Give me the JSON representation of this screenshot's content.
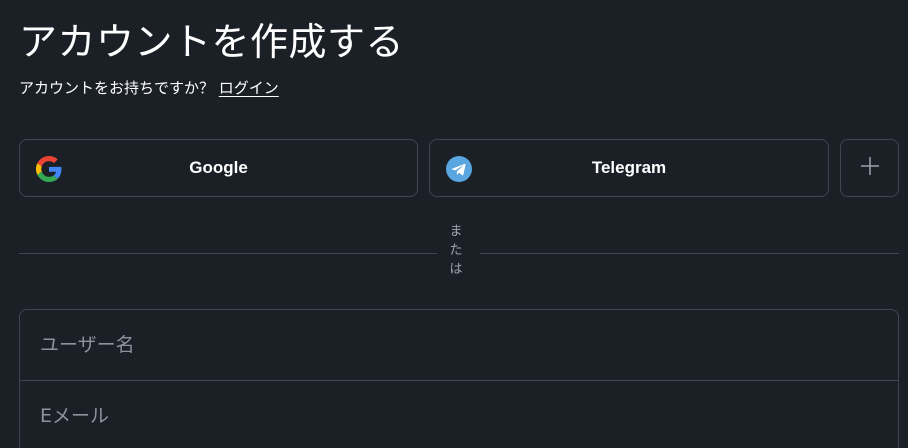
{
  "heading": {
    "title": "アカウントを作成する"
  },
  "login_prompt": {
    "text": "アカウントをお持ちですか？",
    "link_label": "ログイン"
  },
  "social": {
    "google_label": "Google",
    "telegram_label": "Telegram",
    "more_icon": "plus-icon"
  },
  "divider": {
    "text": "または"
  },
  "form": {
    "username_placeholder": "ユーザー名",
    "email_placeholder": "Eメール"
  },
  "colors": {
    "background": "#1b2027",
    "border": "#3f4651",
    "telegram": "#5aa6e0",
    "google_blue": "#4285F4",
    "google_red": "#EA4335",
    "google_yellow": "#FBBC05",
    "google_green": "#34A853"
  }
}
